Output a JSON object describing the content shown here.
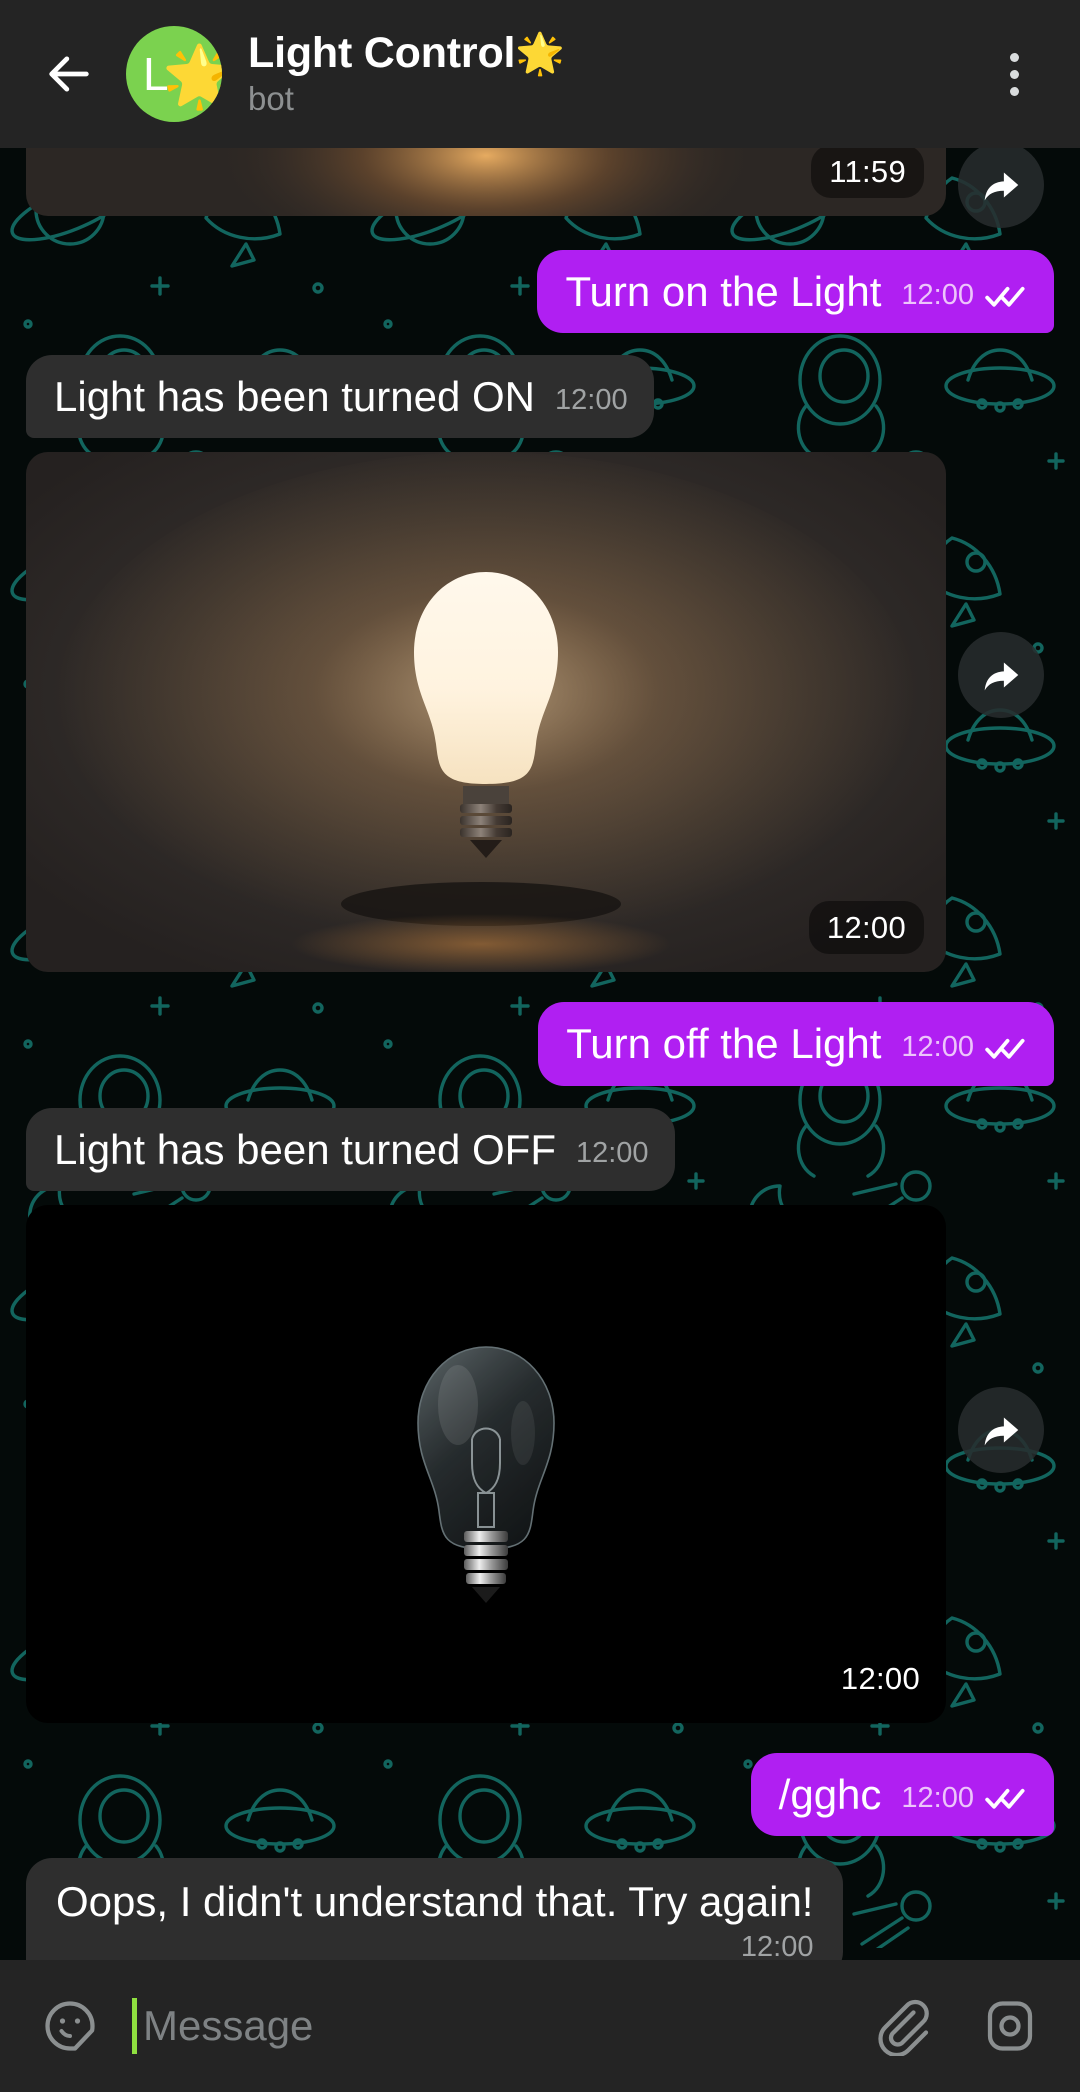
{
  "header": {
    "back_icon": "back-arrow-icon",
    "avatar_letter": "L",
    "avatar_emoji": "🌟",
    "title": "Light Control",
    "title_emoji": "🌟",
    "subtitle": "bot",
    "menu_icon": "overflow-menu-icon",
    "header_bg": "#242424",
    "avatar_bg": "#7bd24f"
  },
  "theme": {
    "outgoing_bubble": "#b01ff2",
    "incoming_bubble": "#2e2e2e",
    "chat_bg": "#050b0a",
    "doodle_stroke": "#12524d",
    "accent_caret": "#8fe040"
  },
  "messages": [
    {
      "id": "m0",
      "type": "photo",
      "direction": "in",
      "clipped": true,
      "image": "lightbulb-on-photo-partial",
      "time": "11:59",
      "forward_icon": "forward-arrow-icon"
    },
    {
      "id": "m1",
      "type": "text",
      "direction": "out",
      "text": "Turn on the Light",
      "time": "12:00",
      "status_icon": "double-check-icon"
    },
    {
      "id": "m2",
      "type": "text",
      "direction": "in",
      "text": "Light has been turned ON",
      "time": "12:00"
    },
    {
      "id": "m3",
      "type": "photo",
      "direction": "in",
      "image": "lightbulb-on-photo",
      "time": "12:00",
      "forward_icon": "forward-arrow-icon"
    },
    {
      "id": "m4",
      "type": "text",
      "direction": "out",
      "text": "Turn off the Light",
      "time": "12:00",
      "status_icon": "double-check-icon"
    },
    {
      "id": "m5",
      "type": "text",
      "direction": "in",
      "text": "Light has been turned OFF",
      "time": "12:00"
    },
    {
      "id": "m6",
      "type": "photo",
      "direction": "in",
      "image": "lightbulb-off-photo",
      "time": "12:00",
      "forward_icon": "forward-arrow-icon"
    },
    {
      "id": "m7",
      "type": "text",
      "direction": "out",
      "text": "/gghc",
      "time": "12:00",
      "status_icon": "double-check-icon"
    },
    {
      "id": "m8",
      "type": "text",
      "direction": "in",
      "stacked": true,
      "text": "Oops, I didn't understand that. Try again!",
      "time": "12:00"
    }
  ],
  "input_bar": {
    "sticker_icon": "sticker-smiley-icon",
    "placeholder": "Message",
    "value": "",
    "attach_icon": "paperclip-icon",
    "camera_icon": "camera-icon"
  }
}
